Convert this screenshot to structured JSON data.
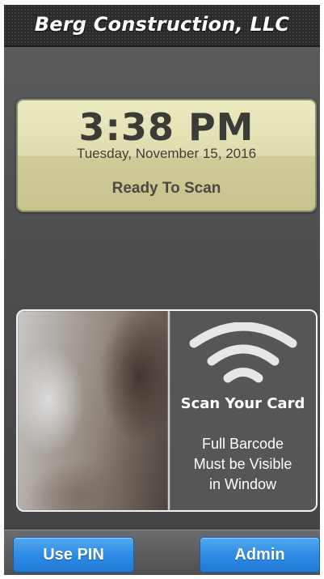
{
  "header": {
    "title": "Berg Construction, LLC"
  },
  "clock": {
    "time": "3:38 PM",
    "date": "Tuesday, November 15, 2016",
    "status": "Ready To Scan"
  },
  "scanner": {
    "icon": "wireless-signal-icon",
    "title": "Scan Your Card",
    "instructions": [
      "Full Barcode",
      "Must be Visible",
      "in Window"
    ]
  },
  "buttons": {
    "use_pin_label": "Use PIN",
    "admin_label": "Admin"
  },
  "colors": {
    "header_bg": "#2a2a2a",
    "background": "#4a4b4d",
    "clock_card": "#dedcae",
    "button_blue": "#2f8ce4",
    "panel_border": "#f2f2f2"
  }
}
